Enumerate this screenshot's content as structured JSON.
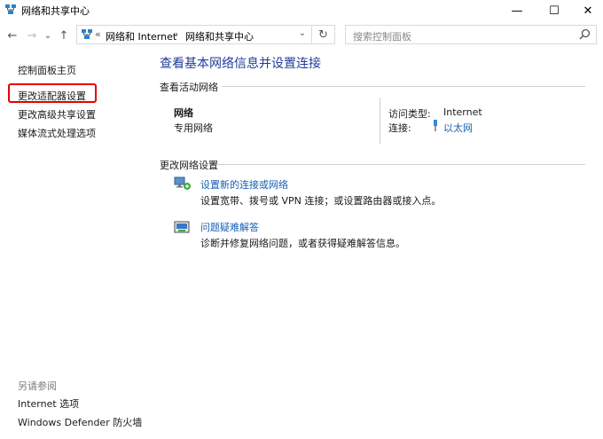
{
  "window": {
    "title": "网络和共享中心",
    "minimize": "—",
    "maximize": "☐",
    "close": "✕"
  },
  "nav": {
    "back": "←",
    "forward": "→",
    "recent": "⌄",
    "up": "↑",
    "address": {
      "overflow": "«",
      "crumb1": "网络和 Internet",
      "sep": "›",
      "crumb2": "网络和共享中心",
      "dropdown": "⌄"
    },
    "refresh": "↻",
    "search_placeholder": "搜索控制面板"
  },
  "sidebar": {
    "items": [
      {
        "label": "控制面板主页"
      },
      {
        "label": "更改适配器设置"
      },
      {
        "label": "更改高级共享设置"
      },
      {
        "label": "媒体流式处理选项"
      }
    ],
    "see_also_title": "另请参阅",
    "see_also": [
      {
        "label": "Internet 选项"
      },
      {
        "label": "Windows Defender 防火墙"
      }
    ]
  },
  "main": {
    "heading": "查看基本网络信息并设置连接",
    "active_networks_title": "查看活动网络",
    "network": {
      "name": "网络",
      "type": "专用网络",
      "access_label": "访问类型:",
      "access_value": "Internet",
      "conn_label": "连接:",
      "conn_value": "以太网"
    },
    "change_settings_title": "更改网络设置",
    "tasks": [
      {
        "title": "设置新的连接或网络",
        "desc": "设置宽带、拨号或 VPN 连接；或设置路由器或接入点。"
      },
      {
        "title": "问题疑难解答",
        "desc": "诊断并修复网络问题，或者获得疑难解答信息。"
      }
    ]
  },
  "colors": {
    "link": "#1a5fb4",
    "heading": "#1f3d99",
    "highlight": "#e60000"
  }
}
